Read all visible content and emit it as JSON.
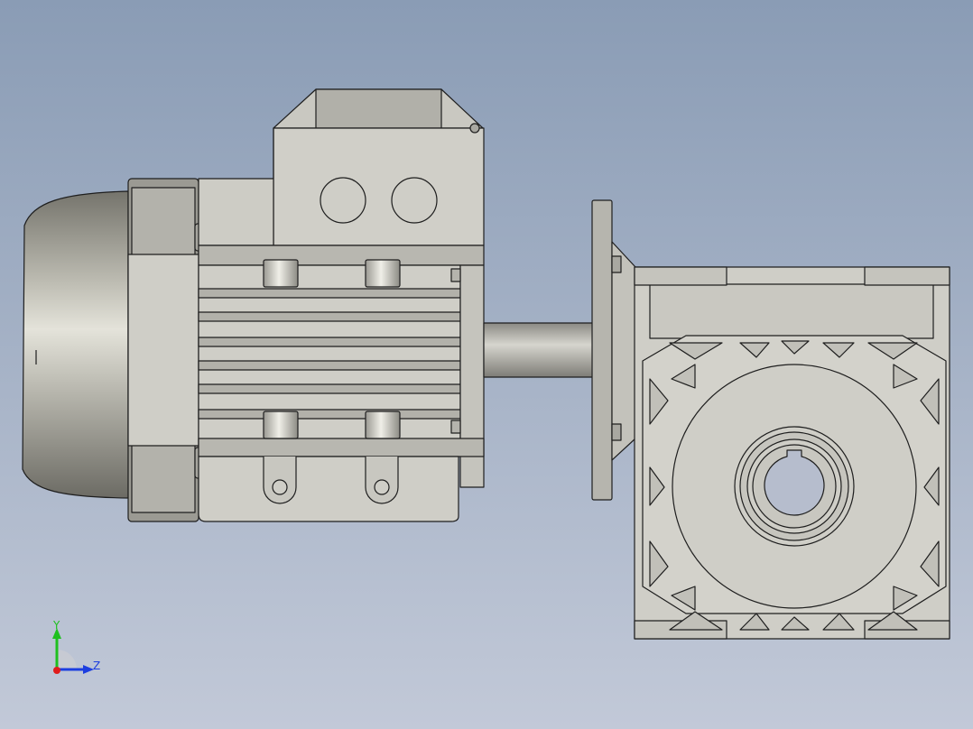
{
  "viewport": {
    "background_top": "#8a9cb5",
    "background_bottom": "#c2c9d8"
  },
  "model": {
    "body_color": "#d0cfc8",
    "shade_color": "#b2b1aa",
    "dark_color": "#8d8c86",
    "line_color": "#1e1e1e"
  },
  "triad": {
    "y_label": "Y",
    "z_label": "Z",
    "y_color": "#1fc01f",
    "z_color": "#1c3ee0",
    "x_color": "#e01c1c"
  }
}
